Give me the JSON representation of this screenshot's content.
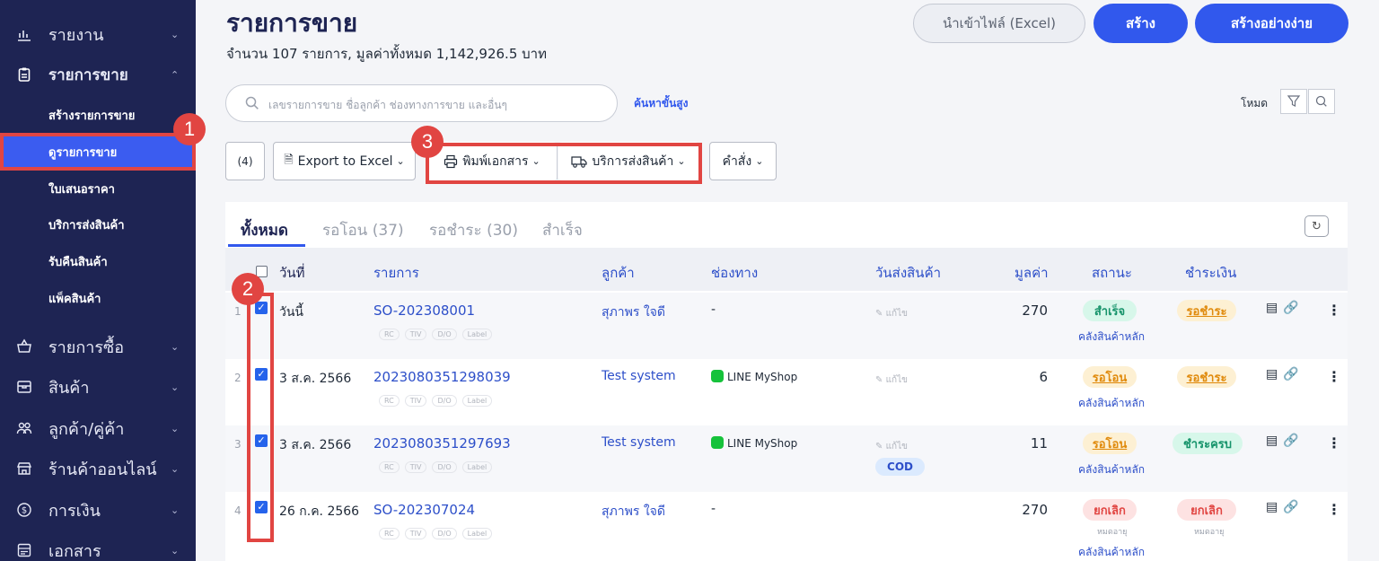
{
  "sidebar": {
    "items": [
      {
        "label": "รายงาน",
        "icon": "chart-bar-icon"
      },
      {
        "label": "รายการขาย",
        "icon": "clipboard-icon"
      },
      {
        "label": "รายการซื้อ",
        "icon": "basket-icon"
      },
      {
        "label": "สินค้า",
        "icon": "box-icon"
      },
      {
        "label": "ลูกค้า/คู่ค้า",
        "icon": "users-icon"
      },
      {
        "label": "ร้านค้าออนไลน์",
        "icon": "store-icon"
      },
      {
        "label": "การเงิน",
        "icon": "dollar-icon"
      },
      {
        "label": "เอกสาร",
        "icon": "document-icon"
      }
    ],
    "sub_items": [
      {
        "label": "สร้างรายการขาย"
      },
      {
        "label": "ดูรายการขาย",
        "active": true
      },
      {
        "label": "ใบเสนอราคา"
      },
      {
        "label": "บริการส่งสินค้า"
      },
      {
        "label": "รับคืนสินค้า"
      },
      {
        "label": "แพ็คสินค้า"
      }
    ]
  },
  "header": {
    "title": "รายการขาย",
    "summary": "จำนวน 107 รายการ, มูลค่าทั้งหมด 1,142,926.5 บาท",
    "import_label": "นำเข้าไฟล์ (Excel)",
    "create_label": "สร้าง",
    "create_simple_label": "สร้างอย่างง่าย"
  },
  "search": {
    "placeholder": "เลขรายการขาย ชื่อลูกค้า ช่องทางการขาย และอื่นๆ",
    "advanced_label": "ค้นหาขั้นสูง",
    "mode_label": "โหมด"
  },
  "toolbar": {
    "count_label": "(4)",
    "export_label": "Export to Excel",
    "print_label": "พิมพ์เอกสาร",
    "ship_label": "บริการส่งสินค้า",
    "command_label": "คำสั่ง"
  },
  "tabs": [
    {
      "label": "ทั้งหมด",
      "active": true
    },
    {
      "label": "รอโอน (37)"
    },
    {
      "label": "รอชำระ (30)"
    },
    {
      "label": "สำเร็จ"
    }
  ],
  "table": {
    "columns": [
      "วันที่",
      "รายการ",
      "ลูกค้า",
      "ช่องทาง",
      "วันส่งสินค้า",
      "มูลค่า",
      "สถานะ",
      "ชำระเงิน"
    ],
    "tag_labels": [
      "RC",
      "TIV",
      "D/O",
      "Label"
    ],
    "edit_label": "แก้ไข",
    "rows": [
      {
        "index": "1",
        "date": "วันนี้",
        "order": "SO-202308001",
        "customer": "สุภาพร ใจดี",
        "channel": "-",
        "channel_line": false,
        "cod": "",
        "value": "270",
        "status": "สำเร็จ",
        "status_kind": "green",
        "status_sub": "",
        "warehouse": "คลังสินค้าหลัก",
        "payment": "รอชำระ",
        "payment_kind": "orange",
        "payment_sub": "",
        "edit": true
      },
      {
        "index": "2",
        "date": "3 ส.ค. 2566",
        "order": "2023080351298039",
        "customer": "Test system",
        "channel": "LINE MyShop",
        "channel_line": true,
        "cod": "",
        "value": "6",
        "status": "รอโอน",
        "status_kind": "orange",
        "status_sub": "",
        "warehouse": "คลังสินค้าหลัก",
        "payment": "รอชำระ",
        "payment_kind": "orange",
        "payment_sub": "",
        "edit": true
      },
      {
        "index": "3",
        "date": "3 ส.ค. 2566",
        "order": "2023080351297693",
        "customer": "Test system",
        "channel": "LINE MyShop",
        "channel_line": true,
        "cod": "COD",
        "value": "11",
        "status": "รอโอน",
        "status_kind": "orange",
        "status_sub": "",
        "warehouse": "คลังสินค้าหลัก",
        "payment": "ชำระครบ",
        "payment_kind": "green",
        "payment_sub": "",
        "edit": true
      },
      {
        "index": "4",
        "date": "26 ก.ค. 2566",
        "order": "SO-202307024",
        "customer": "สุภาพร ใจดี",
        "channel": "-",
        "channel_line": false,
        "cod": "",
        "value": "270",
        "status": "ยกเลิก",
        "status_kind": "red",
        "status_sub": "หมดอายุ",
        "warehouse": "คลังสินค้าหลัก",
        "payment": "ยกเลิก",
        "payment_kind": "red",
        "payment_sub": "หมดอายุ",
        "edit": false
      }
    ]
  },
  "markers": [
    "1",
    "2",
    "3"
  ],
  "colors": {
    "sidebar": "#1e2453",
    "primary": "#3158ed",
    "highlight": "#e14542"
  }
}
